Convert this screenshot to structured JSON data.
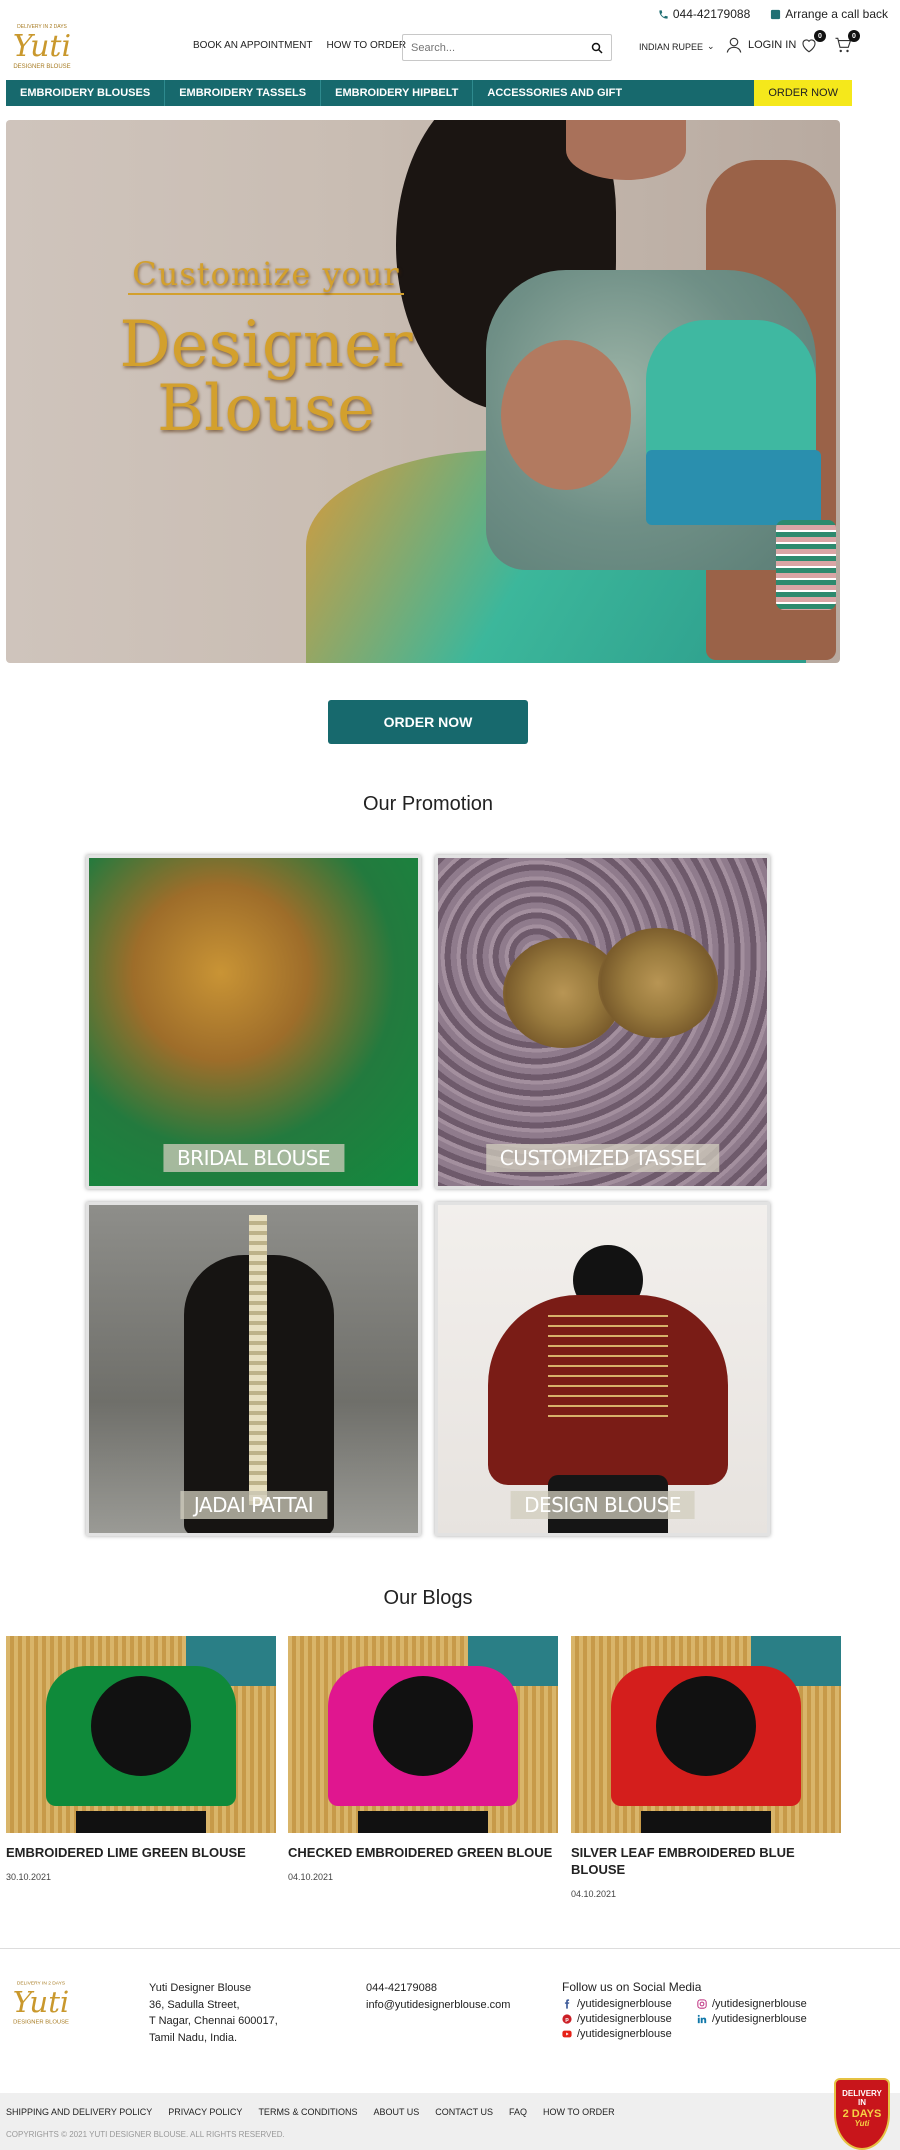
{
  "topbar": {
    "phone": "044-42179088",
    "callback": "Arrange a call back"
  },
  "logo": {
    "tag": "DELIVERY IN 2 DAYS",
    "brand": "Yuti",
    "sub": "DESIGNER BLOUSE"
  },
  "header_nav": [
    {
      "label": "BOOK AN APPOINTMENT"
    },
    {
      "label": "HOW TO ORDER"
    }
  ],
  "search": {
    "placeholder": "Search..."
  },
  "currency": {
    "label": "INDIAN RUPEE"
  },
  "login": {
    "label": "LOGIN IN"
  },
  "wishlist": {
    "count": "0"
  },
  "cart": {
    "count": "0"
  },
  "category_nav": [
    {
      "label": "EMBROIDERY BLOUSES"
    },
    {
      "label": "EMBROIDERY TASSELS"
    },
    {
      "label": "EMBROIDERY HIPBELT"
    },
    {
      "label": "ACCESSORIES AND GIFT"
    }
  ],
  "category_order": "ORDER NOW",
  "hero": {
    "line1": "Customize your",
    "line2": "Designer",
    "line3": "Blouse"
  },
  "order_button": "ORDER NOW",
  "promotion": {
    "title": "Our Promotion",
    "items": [
      {
        "label": "BRIDAL BLOUSE"
      },
      {
        "label": "CUSTOMIZED TASSEL"
      },
      {
        "label": "JADAI PATTAI"
      },
      {
        "label": "DESIGN BLOUSE"
      }
    ]
  },
  "blogs": {
    "title": "Our Blogs",
    "items": [
      {
        "title": "EMBROIDERED LIME GREEN BLOUSE",
        "date": "30.10.2021",
        "color": "#0f8a3a"
      },
      {
        "title": "CHECKED EMBROIDERED GREEN BLOUE",
        "date": "04.10.2021",
        "color": "#e0168f"
      },
      {
        "title": "SILVER LEAF EMBROIDERED BLUE BLOUSE",
        "date": "04.10.2021",
        "color": "#d41e1c"
      }
    ]
  },
  "footer": {
    "address": [
      "Yuti Designer Blouse",
      "36, Sadulla Street,",
      "T Nagar, Chennai 600017,",
      "Tamil Nadu, India."
    ],
    "phone": "044-42179088",
    "email": "info@yutidesignerblouse.com",
    "social_title": "Follow us on Social Media",
    "social": [
      {
        "icon": "facebook-icon",
        "label": "/yutidesignerblouse",
        "color": "#3b5998"
      },
      {
        "icon": "instagram-icon",
        "label": "/yutidesignerblouse",
        "color": "#c13584"
      },
      {
        "icon": "pinterest-icon",
        "label": "/yutidesignerblouse",
        "color": "#cb2027"
      },
      {
        "icon": "linkedin-icon",
        "label": "/yutidesignerblouse",
        "color": "#0e76a8"
      },
      {
        "icon": "youtube-icon",
        "label": "/yutidesignerblouse",
        "color": "#e62117"
      }
    ],
    "links": [
      {
        "label": "SHIPPING AND DELIVERY POLICY"
      },
      {
        "label": "PRIVACY POLICY"
      },
      {
        "label": "TERMS & CONDITIONS"
      },
      {
        "label": "ABOUT US"
      },
      {
        "label": "CONTACT US"
      },
      {
        "label": "FAQ"
      },
      {
        "label": "HOW TO ORDER"
      }
    ],
    "copyright": "COPYRIGHTS © 2021 YUTI DESIGNER BLOUSE. ALL RIGHTS RESERVED."
  },
  "delivery_badge": {
    "line1": "DELIVERY",
    "line2": "IN",
    "line3": "2 DAYS",
    "line4": "Yuti"
  },
  "colors": {
    "primary": "#17696d",
    "accent": "#f5e81b",
    "gold": "#d3a02d"
  }
}
